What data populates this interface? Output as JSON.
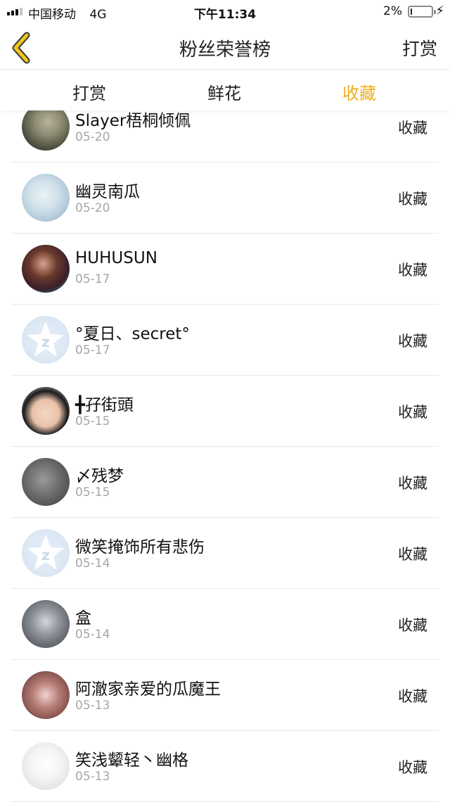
{
  "status_bar": {
    "carrier": "中国移动",
    "network": "4G",
    "time": "下午11:34",
    "battery": "2%",
    "battery_level": 0.02
  },
  "nav": {
    "title": "粉丝荣誉榜",
    "action": "打赏",
    "back_icon": "chevron-left-icon",
    "accent": "#f0ad1e"
  },
  "tabs": [
    {
      "label": "打赏"
    },
    {
      "label": "鲜花"
    },
    {
      "label": "收藏"
    }
  ],
  "active_tab": "收藏",
  "fans": [
    {
      "name": "Slayer梧桐倾佩",
      "date": "05-20",
      "action": "收藏"
    },
    {
      "name": "幽灵南瓜",
      "date": "05-20",
      "action": "收藏"
    },
    {
      "name": "HUHUSUN",
      "date": "05-17",
      "action": "收藏"
    },
    {
      "name": "°夏日、secret°",
      "date": "05-17",
      "action": "收藏"
    },
    {
      "name": "╋孖街頭",
      "date": "05-15",
      "action": "收藏"
    },
    {
      "name": "〆残梦",
      "date": "05-15",
      "action": "收藏"
    },
    {
      "name": "微笑掩饰所有悲伤",
      "date": "05-14",
      "action": "收藏"
    },
    {
      "name": "盒",
      "date": "05-14",
      "action": "收藏"
    },
    {
      "name": "阿澈家亲爱的瓜魔王",
      "date": "05-13",
      "action": "收藏"
    },
    {
      "name": "笑浅颦轻丶幽格",
      "date": "05-13",
      "action": "收藏"
    }
  ]
}
